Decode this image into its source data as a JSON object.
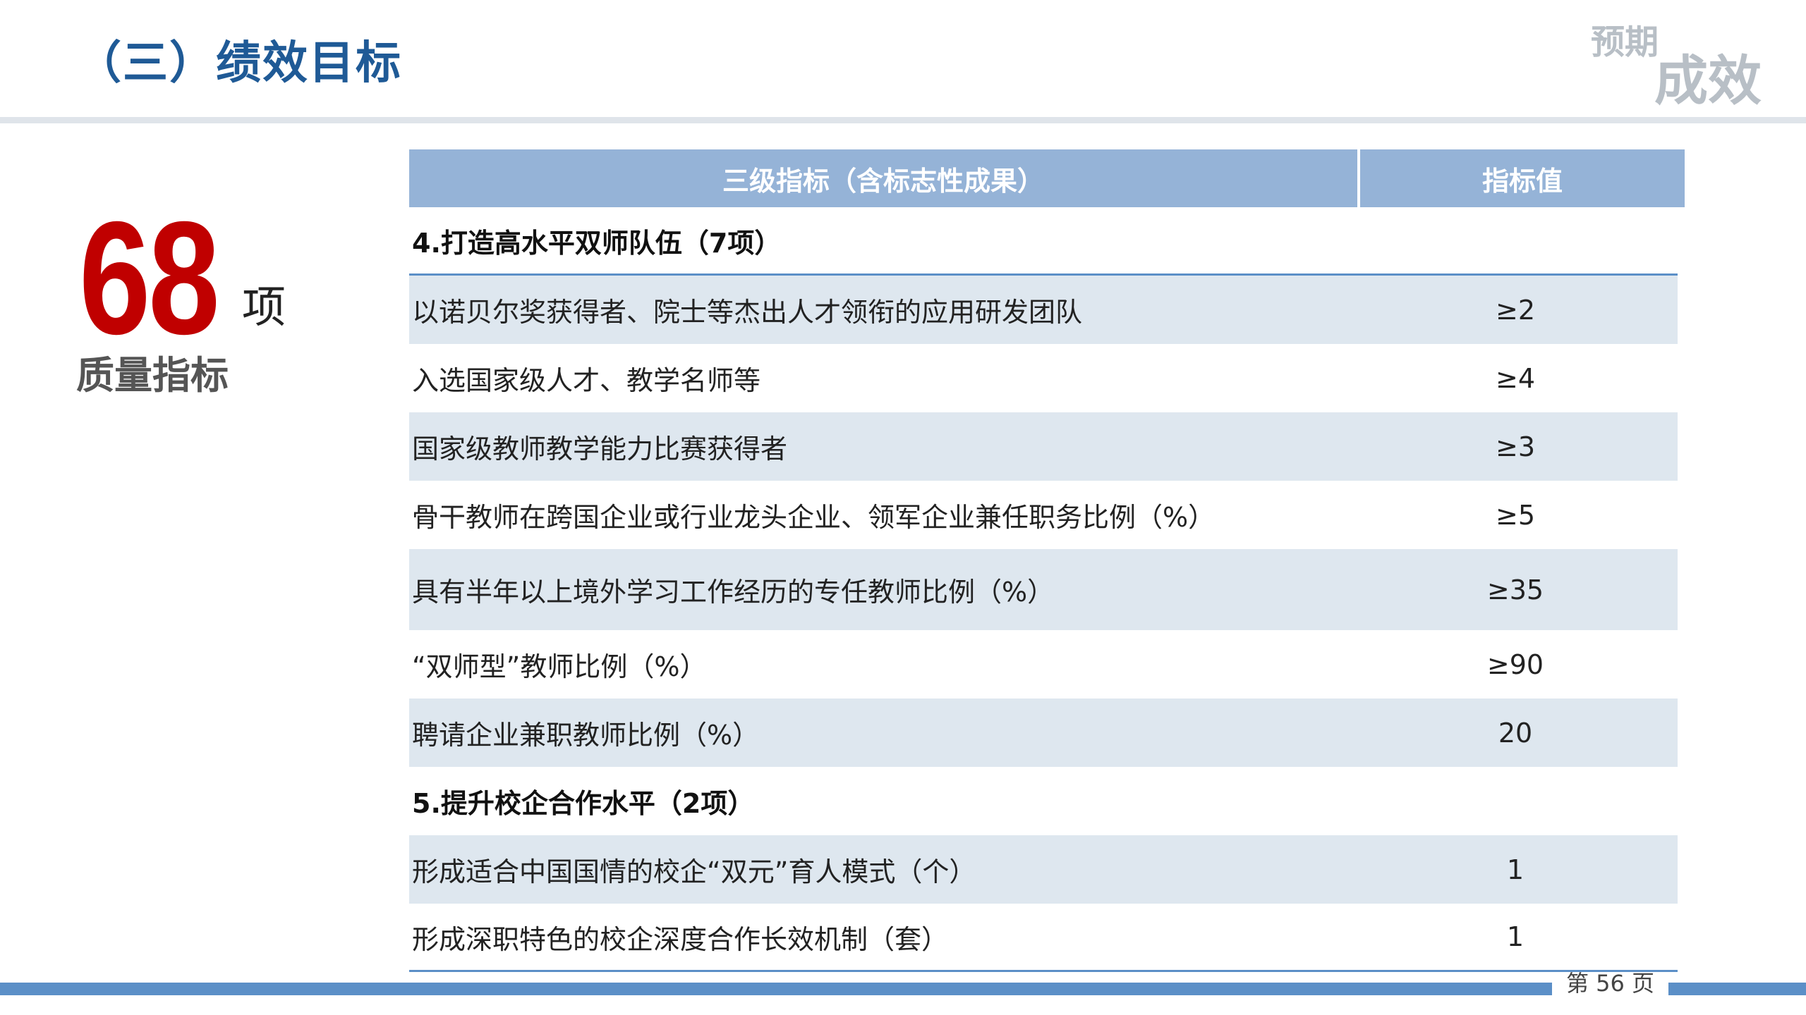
{
  "header": {
    "title": "（三）绩效目标",
    "corner_small": "预期",
    "corner_big": "成效"
  },
  "summary": {
    "number": "68",
    "unit": "项",
    "caption": "质量指标"
  },
  "table": {
    "columns": [
      "三级指标（含标志性成果）",
      "指标值"
    ],
    "rows": [
      {
        "label": "4.打造高水平双师队伍（7项）",
        "value": "",
        "type": "section"
      },
      {
        "label": "以诺贝尔奖获得者、院士等杰出人才领衔的应用研发团队",
        "value": "≥2",
        "type": "item"
      },
      {
        "label": "入选国家级人才、教学名师等",
        "value": "≥4",
        "type": "item"
      },
      {
        "label": "国家级教师教学能力比赛获得者",
        "value": "≥3",
        "type": "item"
      },
      {
        "label": "骨干教师在跨国企业或行业龙头企业、领军企业兼任职务比例（%）",
        "value": "≥5",
        "type": "item"
      },
      {
        "label": "具有半年以上境外学习工作经历的专任教师比例（%）",
        "value": "≥35",
        "type": "item"
      },
      {
        "label": "“双师型”教师比例（%）",
        "value": "≥90",
        "type": "item"
      },
      {
        "label": "聘请企业兼职教师比例（%）",
        "value": "20",
        "type": "item"
      },
      {
        "label": "5.提升校企合作水平（2项）",
        "value": "",
        "type": "section"
      },
      {
        "label": "形成适合中国国情的校企“双元”育人模式（个）",
        "value": "1",
        "type": "item"
      },
      {
        "label": "形成深职特色的校企深度合作长效机制（套）",
        "value": "1",
        "type": "item"
      }
    ]
  },
  "footer": {
    "page_label": "第 56 页"
  }
}
